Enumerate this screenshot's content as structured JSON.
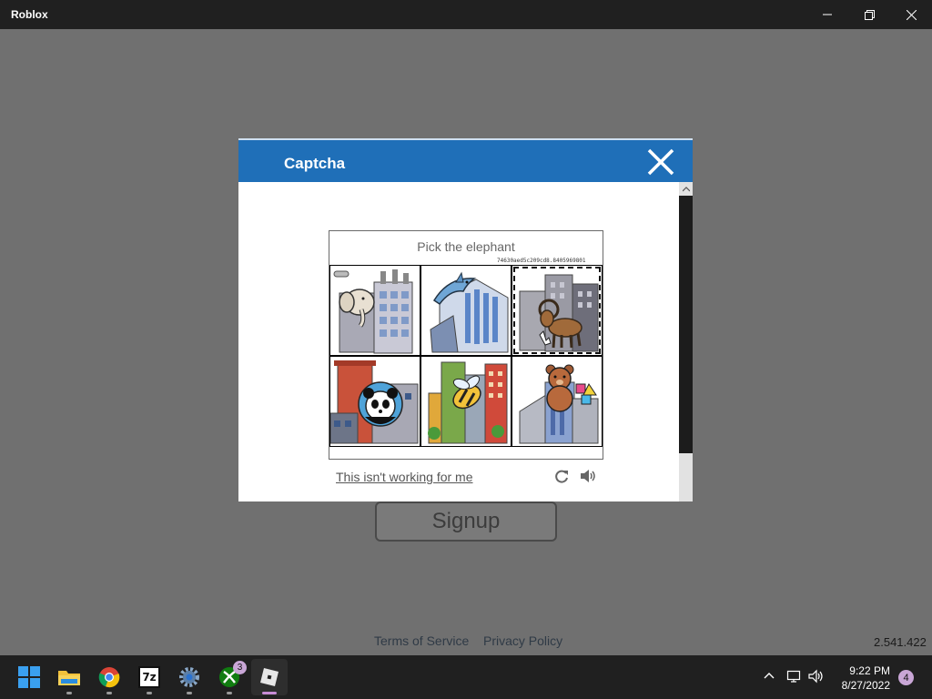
{
  "window": {
    "title": "Roblox"
  },
  "page": {
    "signup_label": "Signup",
    "terms_label": "Terms of Service",
    "privacy_label": "Privacy Policy",
    "version": "2.541.422"
  },
  "captcha": {
    "header_title": "Captcha",
    "prompt": "Pick the elephant",
    "hash": "74630aed5c209cd8.8405969801",
    "help_link": "This isn't working for me",
    "tiles": [
      {
        "subject": "elephant",
        "selected": false
      },
      {
        "subject": "dolphin",
        "selected": false
      },
      {
        "subject": "goat",
        "selected": true
      },
      {
        "subject": "panda",
        "selected": false
      },
      {
        "subject": "bee",
        "selected": false
      },
      {
        "subject": "teddy-bear",
        "selected": false
      }
    ],
    "icons": {
      "refresh": "refresh-icon",
      "audio": "speaker-icon"
    }
  },
  "taskbar": {
    "apps": [
      {
        "name": "start",
        "icon": "windows-start-icon"
      },
      {
        "name": "file-explorer",
        "icon": "folder-icon"
      },
      {
        "name": "chrome",
        "icon": "chrome-icon"
      },
      {
        "name": "7zip",
        "icon": "7zip-icon",
        "text": "7z"
      },
      {
        "name": "settings",
        "icon": "gear-icon"
      },
      {
        "name": "xbox",
        "icon": "xbox-icon",
        "badge": "3"
      },
      {
        "name": "roblox",
        "icon": "roblox-icon",
        "active": true
      }
    ],
    "clock": {
      "time": "9:22 PM",
      "date": "8/27/2022"
    },
    "notification_count": "4"
  },
  "colors": {
    "captcha_header": "#1f6fb8",
    "dim_overlay": "#707070",
    "taskbar": "#202020",
    "active_indicator": "#c88cd6"
  }
}
